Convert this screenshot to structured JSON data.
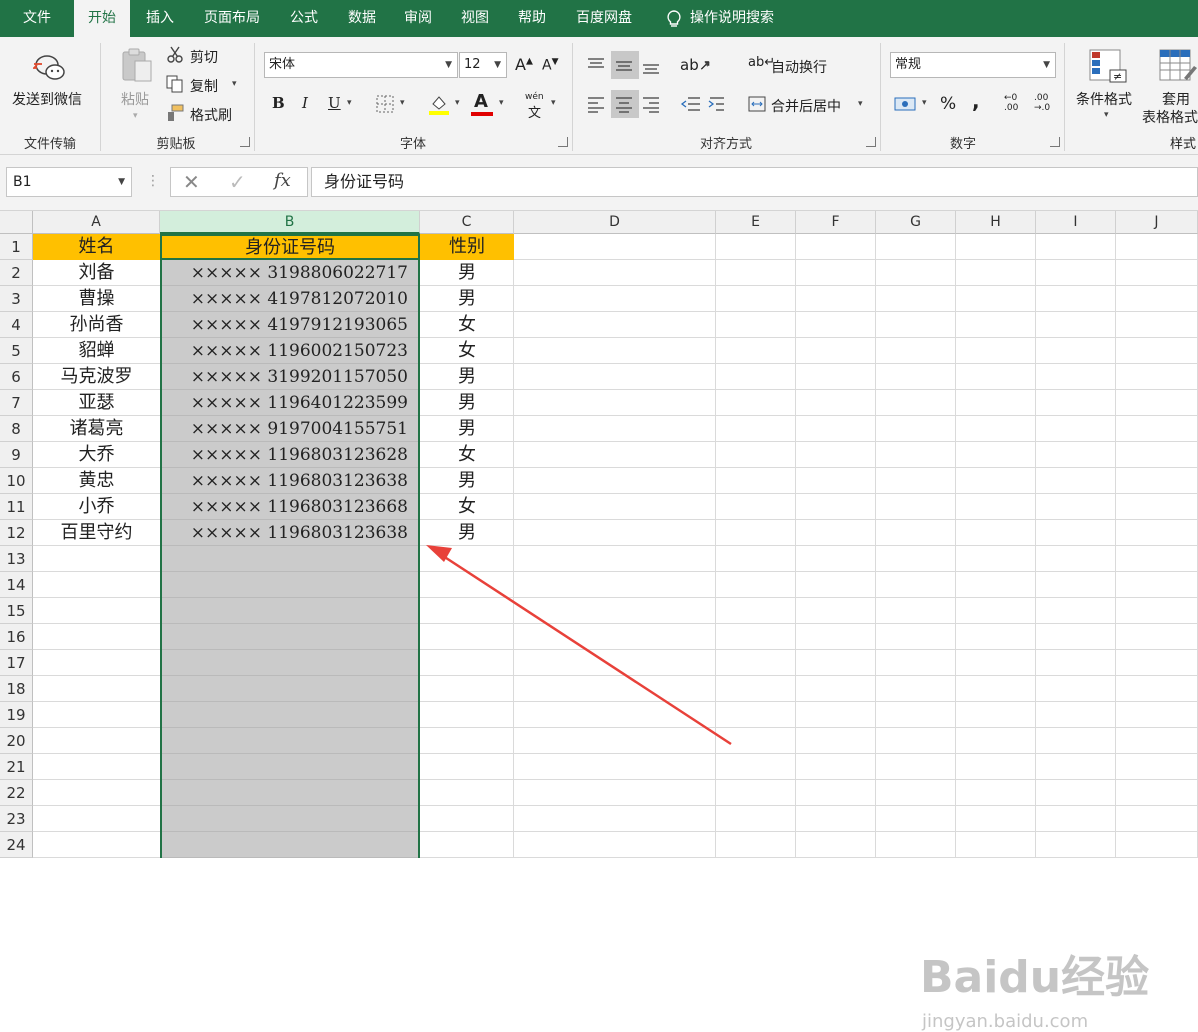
{
  "menu": {
    "tabs": [
      "文件",
      "开始",
      "插入",
      "页面布局",
      "公式",
      "数据",
      "审阅",
      "视图",
      "帮助",
      "百度网盘"
    ],
    "active": "开始",
    "search_label": "操作说明搜索"
  },
  "ribbon": {
    "send_wechat": "发送到微信",
    "group_file_transfer": "文件传输",
    "paste": "粘贴",
    "cut": "剪切",
    "copy": "复制",
    "format_painter": "格式刷",
    "group_clipboard": "剪贴板",
    "font_name": "宋体",
    "font_size": "12",
    "group_font": "字体",
    "bold": "B",
    "italic": "I",
    "underline": "U",
    "phonetic_label": "wén",
    "phonetic_char": "文",
    "wrap_text": "自动换行",
    "merge_center": "合并后居中",
    "group_alignment": "对齐方式",
    "number_format": "常规",
    "percent": "%",
    "comma": ",",
    "group_number": "数字",
    "conditional_format": "条件格式",
    "table_format_line1": "套用",
    "table_format_line2": "表格格式",
    "group_styles": "样式"
  },
  "formula_bar": {
    "name_box": "B1",
    "formula": "身份证号码",
    "fx": "fx"
  },
  "columns": [
    "A",
    "B",
    "C",
    "D",
    "E",
    "F",
    "G",
    "H",
    "I",
    "J"
  ],
  "rows": [
    "1",
    "2",
    "3",
    "4",
    "5",
    "6",
    "7",
    "8",
    "9",
    "10",
    "11",
    "12",
    "13",
    "14",
    "15",
    "16",
    "17",
    "18",
    "19",
    "20",
    "21",
    "22",
    "23",
    "24"
  ],
  "table": {
    "headers": [
      "姓名",
      "身份证号码",
      "性别"
    ],
    "records": [
      [
        "刘备",
        "××××× 3198806022717",
        "男"
      ],
      [
        "曹操",
        "××××× 4197812072010",
        "男"
      ],
      [
        "孙尚香",
        "××××× 4197912193065",
        "女"
      ],
      [
        "貂蝉",
        "××××× 1196002150723",
        "女"
      ],
      [
        "马克波罗",
        "××××× 3199201157050",
        "男"
      ],
      [
        "亚瑟",
        "××××× 1196401223599",
        "男"
      ],
      [
        "诸葛亮",
        "××××× 9197004155751",
        "男"
      ],
      [
        "大乔",
        "××××× 1196803123628",
        "女"
      ],
      [
        "黄忠",
        "××××× 1196803123638",
        "男"
      ],
      [
        "小乔",
        "××××× 1196803123668",
        "女"
      ],
      [
        "百里守约",
        "××××× 1196803123638",
        "男"
      ]
    ]
  },
  "colors": {
    "brand": "#217346",
    "header_fill": "#ffc000",
    "selection": "#a0a0a0",
    "arrow": "#e8413a"
  },
  "watermark": {
    "main": "Baidu经验",
    "sub": "jingyan.baidu.com"
  }
}
